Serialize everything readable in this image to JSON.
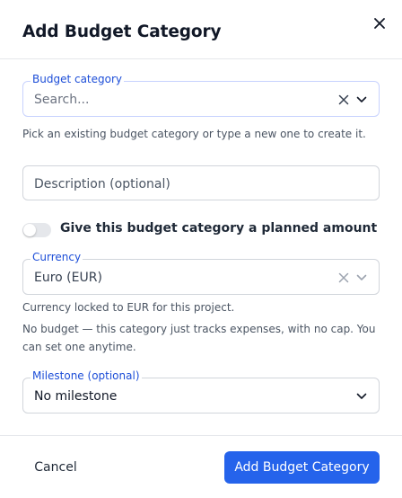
{
  "dialog": {
    "title": "Add Budget Category",
    "close_icon": "close-icon"
  },
  "budget_category": {
    "label": "Budget category",
    "placeholder": "Search...",
    "helper": "Pick an existing budget category or type a new one to create it."
  },
  "description": {
    "placeholder": "Description (optional)"
  },
  "planned_amount": {
    "label": "Give this budget category a planned amount",
    "enabled": false
  },
  "currency": {
    "label": "Currency",
    "value": "Euro (EUR)",
    "helper": "Currency locked to EUR for this project."
  },
  "budget_note": "No budget — this category just tracks expenses, with no cap. You can set one anytime.",
  "milestone": {
    "label": "Milestone (optional)",
    "value": "No milestone"
  },
  "footer": {
    "cancel_label": "Cancel",
    "submit_label": "Add Budget Category"
  },
  "colors": {
    "primary": "#2563eb",
    "label_blue": "#1d4ed8"
  }
}
